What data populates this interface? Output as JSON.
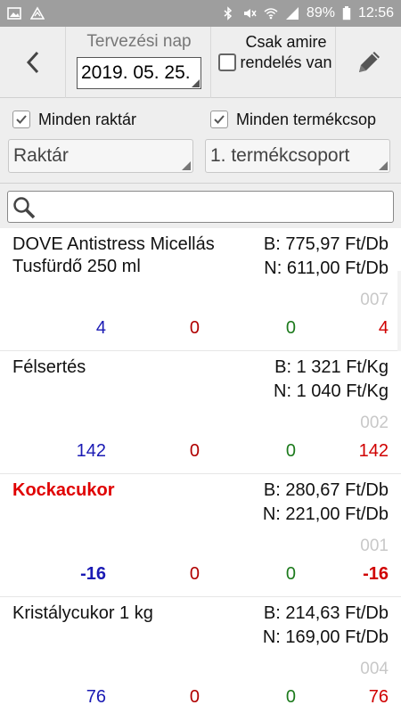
{
  "statusbar": {
    "left_icons": [
      "image-icon",
      "triangle-alert-icon"
    ],
    "battery_percent": "89%",
    "time": "12:56"
  },
  "header": {
    "date_label": "Tervezési nap",
    "date_value": "2019. 05. 25.",
    "only_ordered_label": "Csak amire rendelés van",
    "only_ordered_checked": false
  },
  "filters": {
    "all_warehouses_label": "Minden raktár",
    "all_warehouses_checked": true,
    "all_groups_label": "Minden termékcsop",
    "all_groups_checked": true,
    "warehouse_spinner": "Raktár",
    "group_spinner": "1. termékcsoport"
  },
  "search": {
    "placeholder": ""
  },
  "products": [
    {
      "name": "DOVE Antistress Micellás Tusfürdő 250 ml",
      "highlight": false,
      "price_b": "B: 775,97 Ft/Db",
      "price_n": "N: 611,00 Ft/Db",
      "code": "007",
      "v1": "4",
      "v2": "0",
      "v3": "0",
      "v4": "4",
      "bold_values": false
    },
    {
      "name": "Félsertés",
      "highlight": false,
      "price_b": "B: 1 321 Ft/Kg",
      "price_n": "N: 1 040 Ft/Kg",
      "code": "002",
      "v1": "142",
      "v2": "0",
      "v3": "0",
      "v4": "142",
      "bold_values": false
    },
    {
      "name": "Kockacukor",
      "highlight": true,
      "price_b": "B: 280,67 Ft/Db",
      "price_n": "N: 221,00 Ft/Db",
      "code": "001",
      "v1": "-16",
      "v2": "0",
      "v3": "0",
      "v4": "-16",
      "bold_values": true
    },
    {
      "name": "Kristálycukor 1 kg",
      "highlight": false,
      "price_b": "B: 214,63 Ft/Db",
      "price_n": "N: 169,00 Ft/Db",
      "code": "004",
      "v1": "76",
      "v2": "0",
      "v3": "0",
      "v4": "76",
      "bold_values": false
    }
  ]
}
